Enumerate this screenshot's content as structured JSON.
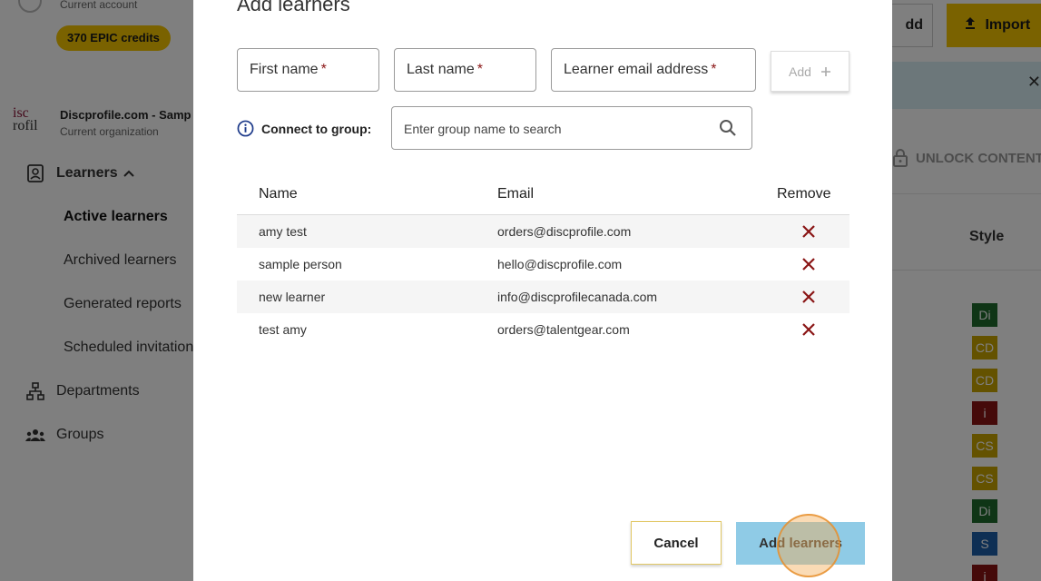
{
  "sidebar": {
    "account_sub": "Current account",
    "credits": "370 EPIC credits",
    "org_logo_line1": "isc",
    "org_logo_line2": "rofil",
    "org_name": "Discprofile.com - Samp",
    "org_sub": "Current organization",
    "learners_label": "Learners",
    "sub_items": [
      "Active learners",
      "Archived learners",
      "Generated reports",
      "Scheduled invitation"
    ],
    "departments_label": "Departments",
    "groups_label": "Groups"
  },
  "background_main": {
    "add_label": "dd",
    "import_label": "Import",
    "banner_close": "✕",
    "unlock_label": "UNLOCK CONTENT",
    "style_header": "Style",
    "style_badges": [
      {
        "label": "Di",
        "color": "#1f6b2c"
      },
      {
        "label": "CD",
        "color": "#c9a400"
      },
      {
        "label": "CD",
        "color": "#c9a400"
      },
      {
        "label": "i",
        "color": "#8a1515"
      },
      {
        "label": "CS",
        "color": "#c9a400"
      },
      {
        "label": "CS",
        "color": "#c9a400"
      },
      {
        "label": "Di",
        "color": "#1f6b2c"
      },
      {
        "label": "S",
        "color": "#1d5fa8"
      },
      {
        "label": "i",
        "color": "#8a1515"
      }
    ]
  },
  "modal": {
    "title": "Add learners",
    "first_name_label": "First name",
    "last_name_label": "Last name",
    "email_label": "Learner email address",
    "required_mark": "*",
    "add_button_label": "Add",
    "connect_label": "Connect to group:",
    "group_search_placeholder": "Enter group name to search",
    "table": {
      "headers": {
        "name": "Name",
        "email": "Email",
        "remove": "Remove"
      },
      "rows": [
        {
          "name": "amy test",
          "email": "orders@discprofile.com"
        },
        {
          "name": "sample person",
          "email": "hello@discprofile.com"
        },
        {
          "name": "new learner",
          "email": "info@discprofilecanada.com"
        },
        {
          "name": "test amy",
          "email": "orders@talentgear.com"
        }
      ]
    },
    "cancel_label": "Cancel",
    "submit_label": "Add learners"
  },
  "colors": {
    "accent_yellow": "#f5c400",
    "primary_button": "#8fcbe6",
    "remove_icon": "#8a1515",
    "required": "#8a1515"
  }
}
